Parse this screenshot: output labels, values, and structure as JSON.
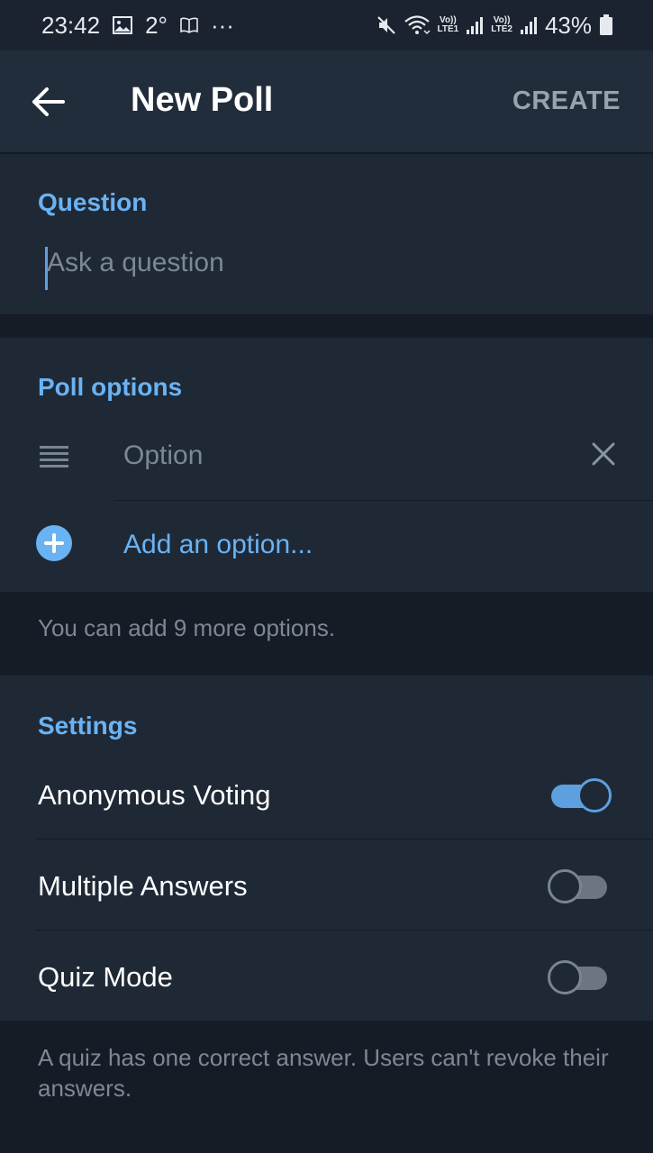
{
  "status_bar": {
    "time": "23:42",
    "temperature": "2°",
    "more": "···",
    "net1_top": "Vo))",
    "net1_bottom": "LTE1",
    "net2_top": "Vo))",
    "net2_bottom": "LTE2",
    "battery": "43%"
  },
  "header": {
    "title": "New Poll",
    "create_label": "CREATE"
  },
  "question": {
    "section_title": "Question",
    "placeholder": "Ask a question"
  },
  "options": {
    "section_title": "Poll options",
    "option_placeholder": "Option",
    "add_label": "Add an option...",
    "hint": "You can add 9 more options."
  },
  "settings": {
    "section_title": "Settings",
    "items": [
      {
        "label": "Anonymous Voting",
        "enabled": true
      },
      {
        "label": "Multiple Answers",
        "enabled": false
      },
      {
        "label": "Quiz Mode",
        "enabled": false
      }
    ],
    "quiz_hint": "A quiz has one correct answer. Users can't revoke their answers."
  },
  "colors": {
    "accent": "#6ab3f3",
    "background": "#161c26",
    "section_background": "#1f2936",
    "header_background": "#212d3b",
    "muted_text": "#7d8895"
  },
  "icons": [
    "back-arrow-icon",
    "gallery-icon",
    "book-icon",
    "mute-icon",
    "wifi-icon",
    "signal-icon",
    "battery-icon",
    "drag-handle-icon",
    "close-icon",
    "plus-circle-icon"
  ]
}
